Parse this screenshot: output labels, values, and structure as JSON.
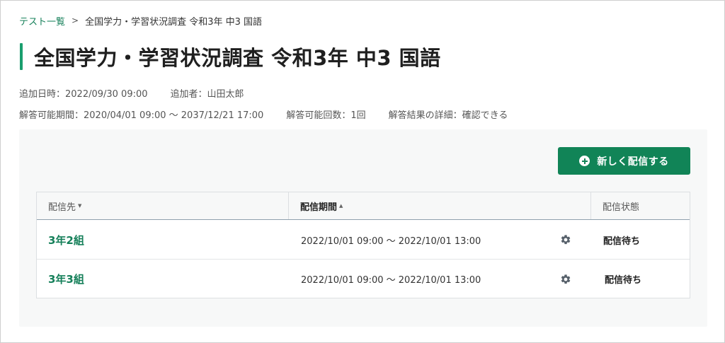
{
  "breadcrumb": {
    "parent": "テスト一覧",
    "separator": ">",
    "current": "全国学力・学習状況調査 令和3年 中3 国語"
  },
  "page_title": "全国学力・学習状況調査 令和3年 中3 国語",
  "meta": {
    "added_datetime": "追加日時：2022/09/30 09:00",
    "added_by": "追加者：山田太郎",
    "answer_period": "解答可能期間：2020/04/01 09:00 〜 2037/12/21 17:00",
    "answer_count": "解答可能回数：1回",
    "result_detail": "解答結果の詳細：確認できる"
  },
  "new_button": {
    "label": "新しく配信する",
    "icon": "plus-circle-icon"
  },
  "table": {
    "columns": [
      {
        "label": "配信先",
        "sort": "desc"
      },
      {
        "label": "配信期間",
        "sort": "asc"
      },
      {
        "label": "配信状態"
      }
    ],
    "rows": [
      {
        "name": "3年2組",
        "period": "2022/10/01 09:00 〜 2022/10/01 13:00",
        "settings_icon": "gear-icon",
        "status": "配信待ち"
      },
      {
        "name": "3年3組",
        "period": "2022/10/01 09:00 〜 2022/10/01 13:00",
        "settings_icon": "gear-icon",
        "status": "配信待ち"
      }
    ]
  },
  "colors": {
    "accent_green": "#118457",
    "link_green": "#16805a",
    "title_bar": "#1a9e6e"
  }
}
